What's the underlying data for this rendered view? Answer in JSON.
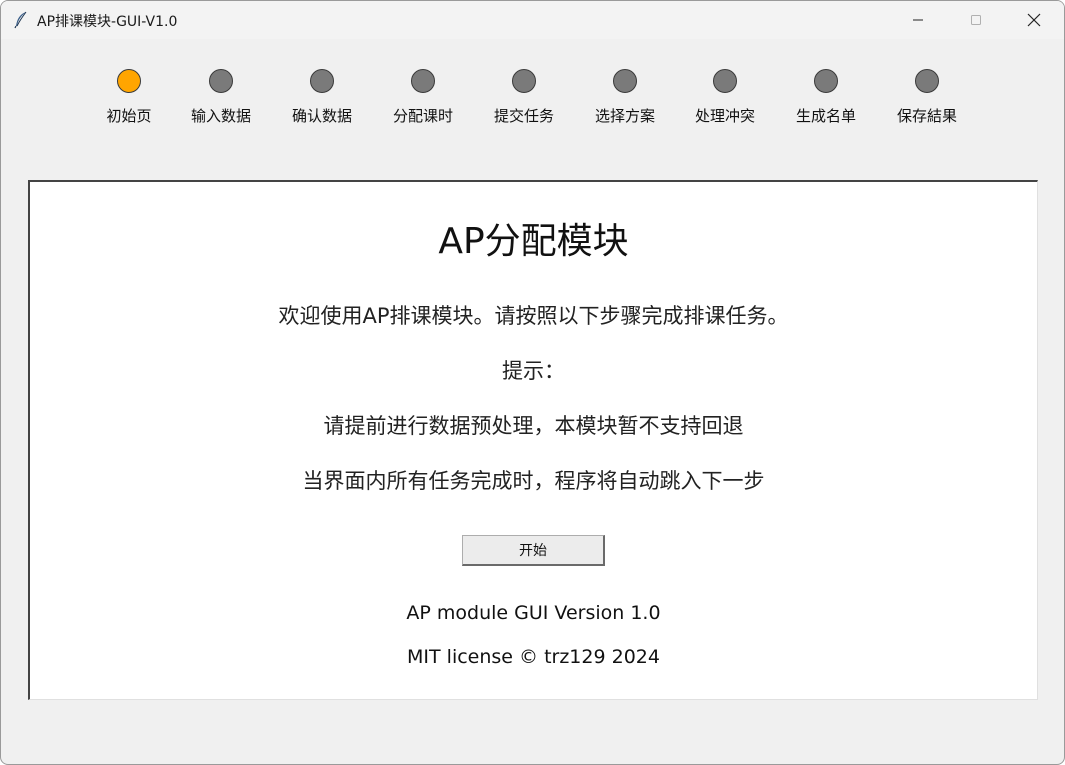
{
  "window": {
    "title": "AP排课模块-GUI-V1.0",
    "app_icon": "feather-icon",
    "controls": [
      "minimize-icon",
      "maximize-icon",
      "close-icon"
    ]
  },
  "steps": {
    "items": [
      {
        "label": "初始页",
        "active": true
      },
      {
        "label": "输入数据",
        "active": false
      },
      {
        "label": "确认数据",
        "active": false
      },
      {
        "label": "分配课时",
        "active": false
      },
      {
        "label": "提交任务",
        "active": false
      },
      {
        "label": "选择方案",
        "active": false
      },
      {
        "label": "处理冲突",
        "active": false
      },
      {
        "label": "生成名单",
        "active": false
      },
      {
        "label": "保存結果",
        "active": false
      }
    ],
    "active_color": "#ffa500",
    "inactive_color": "#7a7a7a"
  },
  "main": {
    "title": "AP分配模块",
    "welcome": "欢迎使用AP排课模块。请按照以下步骤完成排课任务。",
    "hint_label": "提示：",
    "hint_1": "请提前进行数据预处理，本模块暂不支持回退",
    "hint_2": "当界面内所有任务完成时，程序将自动跳入下一步",
    "start_button": "开始",
    "version": "AP module GUI Version 1.0",
    "license": "MIT license © trz129 2024"
  }
}
